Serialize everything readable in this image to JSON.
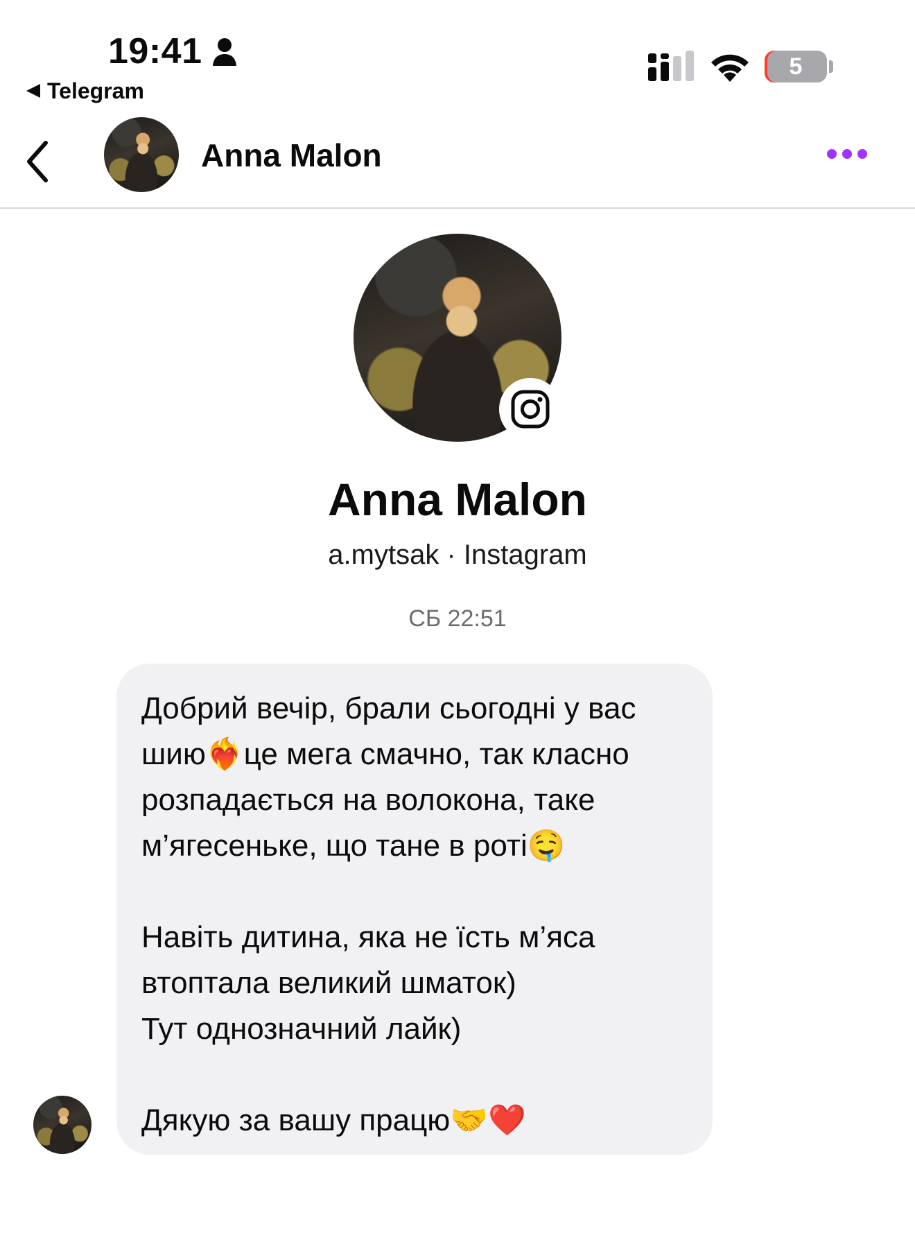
{
  "status_bar": {
    "time": "19:41",
    "back_app": "Telegram",
    "battery_level": "5",
    "icons": [
      "person-icon",
      "cellular-signal-icon",
      "wifi-icon",
      "battery-icon"
    ]
  },
  "header": {
    "name": "Anna Malon",
    "icons": [
      "back-chevron-icon",
      "more-options-icon"
    ],
    "accent_color": "#a033ff"
  },
  "profile": {
    "name": "Anna Malon",
    "handle_line": "a.mytsak · Instagram",
    "badge_icon": "instagram-icon"
  },
  "chat": {
    "timestamp": "СБ 22:51",
    "messages": [
      {
        "text": "Добрий вечір, брали сьогодні у вас шию❤️‍🔥це мега смачно, так класно розпадається на волокона, таке м’ягесеньке, що тане в роті🤤\n\nНавіть дитина, яка не їсть м’яса втоптала великий шматок)\nТут однозначний лайк)\n\nДякую за вашу працю🤝❤️"
      }
    ]
  }
}
